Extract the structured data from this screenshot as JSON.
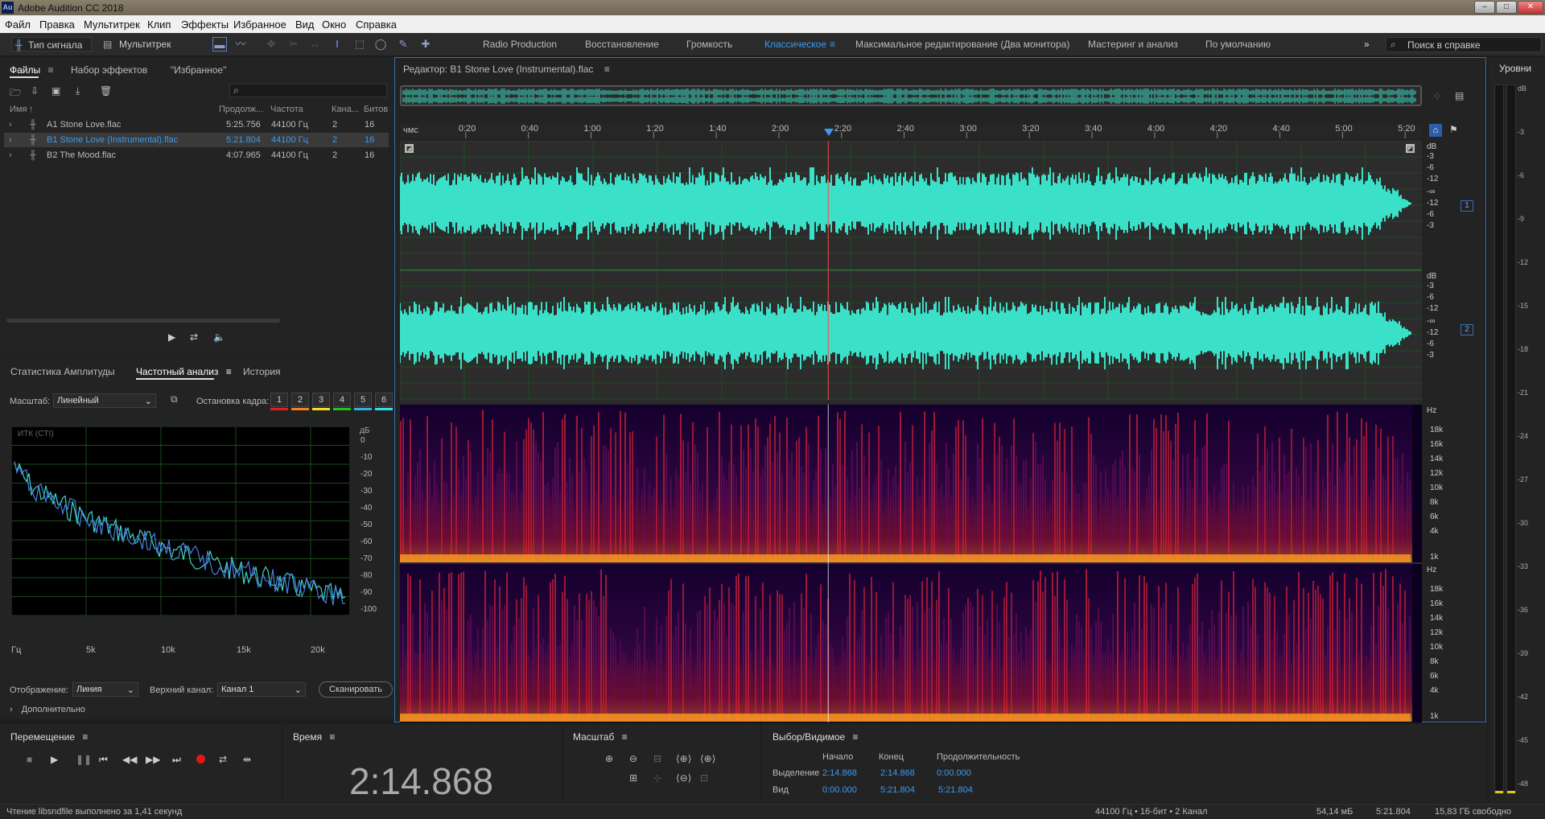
{
  "window": {
    "title": "Adobe Audition CC 2018",
    "app_icon": "Au"
  },
  "menu": [
    "Файл",
    "Правка",
    "Мультитрек",
    "Клип",
    "Эффекты",
    "Избранное",
    "Вид",
    "Окно",
    "Справка"
  ],
  "toolbar": {
    "waveform_btn": "Тип сигнала",
    "multitrack_btn": "Мультитрек",
    "search_placeholder": "Поиск в справке"
  },
  "workspaces": [
    "Radio Production",
    "Восстановление",
    "Громкость",
    "Классическое",
    "Максимальное редактирование (Два монитора)",
    "Мастеринг и анализ",
    "По умолчанию"
  ],
  "active_workspace": "Классическое",
  "files_panel": {
    "tabs": [
      "Файлы",
      "Набор эффектов",
      "\"Избранное\""
    ],
    "columns": [
      "Имя",
      "Продолж...",
      "Частота",
      "Кана...",
      "Битов"
    ],
    "rows": [
      {
        "name": "A1 Stone Love.flac",
        "duration": "5:25.756",
        "rate": "44100 Гц",
        "ch": "2",
        "bits": "16",
        "selected": false
      },
      {
        "name": "B1 Stone Love (Instrumental).flac",
        "duration": "5:21.804",
        "rate": "44100 Гц",
        "ch": "2",
        "bits": "16",
        "selected": true
      },
      {
        "name": "B2 The Mood.flac",
        "duration": "4:07.965",
        "rate": "44100 Гц",
        "ch": "2",
        "bits": "16",
        "selected": false
      }
    ]
  },
  "analysis_panel": {
    "tabs": [
      "Статистика Амплитуды",
      "Частотный анализ",
      "История"
    ],
    "scale_label": "Масштаб:",
    "scale_value": "Линейный",
    "freeze_label": "Остановка кадра:",
    "freeze_buttons": [
      "1",
      "2",
      "3",
      "4",
      "5",
      "6"
    ],
    "freeze_colors": [
      "#e02020",
      "#f08020",
      "#f0e020",
      "#20c020",
      "#30b0e0",
      "#30e0e0"
    ],
    "graph_label": "ИТК (CTI)",
    "db_unit": "дБ",
    "db_ticks": [
      "0",
      "-10",
      "-20",
      "-30",
      "-40",
      "-50",
      "-60",
      "-70",
      "-80",
      "-90",
      "-100"
    ],
    "freq_ticks": [
      "Гц",
      "5k",
      "10k",
      "15k",
      "20k"
    ],
    "display_label": "Отображение:",
    "display_value": "Линия",
    "channel_label": "Верхний канал:",
    "channel_value": "Канал 1",
    "scan_btn": "Сканировать",
    "advanced": "Дополнительно"
  },
  "editor": {
    "title": "Редактор: B1 Stone Love (Instrumental).flac",
    "ruler_unit": "чмс",
    "ruler": [
      "0:20",
      "0:40",
      "1:00",
      "1:20",
      "1:40",
      "2:00",
      "2:20",
      "2:40",
      "3:00",
      "3:20",
      "3:40",
      "4:00",
      "4:20",
      "4:40",
      "5:00",
      "5:20"
    ],
    "db_scale": [
      "dB",
      "-3",
      "-6",
      "-12",
      "-∞",
      "-12",
      "-6",
      "-3"
    ],
    "channels": [
      "1",
      "2"
    ],
    "hz_scale": [
      "Hz",
      "18k",
      "16k",
      "14k",
      "12k",
      "10k",
      "8k",
      "6k",
      "4k",
      "1k"
    ],
    "playhead_time": 2.248,
    "duration": 321.804
  },
  "levels": {
    "title": "Уровни",
    "ticks": [
      "dB",
      "-3",
      "-6",
      "-9",
      "-12",
      "-15",
      "-18",
      "-21",
      "-24",
      "-27",
      "-30",
      "-33",
      "-36",
      "-39",
      "-42",
      "-45",
      "-48"
    ]
  },
  "transport": {
    "title": "Перемещение"
  },
  "time": {
    "title": "Время",
    "value": "2:14.868"
  },
  "zoom": {
    "title": "Масштаб"
  },
  "selection": {
    "title": "Выбор/Видимое",
    "col_start": "Начало",
    "col_end": "Конец",
    "col_dur": "Продолжительность",
    "sel_label": "Выделение",
    "sel_start": "2:14.868",
    "sel_end": "2:14.868",
    "sel_dur": "0:00.000",
    "view_label": "Вид",
    "view_start": "0:00.000",
    "view_end": "5:21.804",
    "view_dur": "5:21.804"
  },
  "status": {
    "left": "Чтение libsndfile выполнено за 1,41 секунд",
    "format": "44100 Гц • 16-бит • 2 Канал",
    "size": "54,14 мБ",
    "dur": "5:21.804",
    "free": "15,83 ГБ свободно"
  }
}
